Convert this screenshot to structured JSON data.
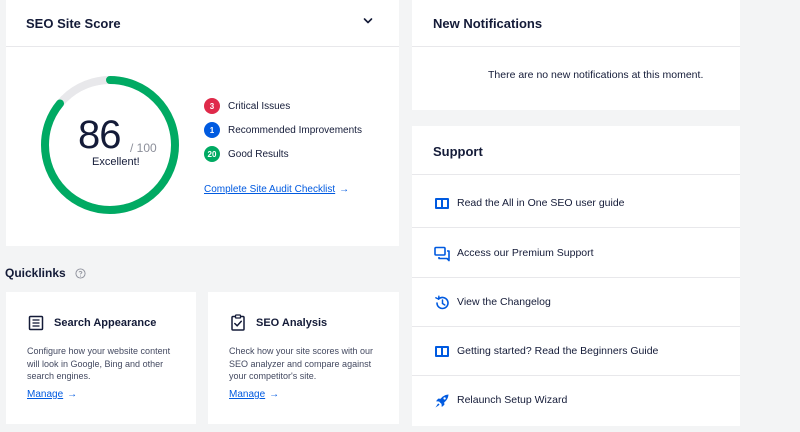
{
  "seo_score": {
    "title": "SEO Site Score",
    "score": "86",
    "total": "/ 100",
    "rating": "Excellent!",
    "score_value": 86,
    "score_max": 100,
    "ring_color": "#00aa63",
    "stats": [
      {
        "count": "3",
        "label": "Critical Issues",
        "color": "#df2a4a"
      },
      {
        "count": "1",
        "label": "Recommended Improvements",
        "color": "#005ae0"
      },
      {
        "count": "20",
        "label": "Good Results",
        "color": "#00aa63"
      }
    ],
    "audit_link": "Complete Site Audit Checklist",
    "audit_arrow": "→"
  },
  "notifications": {
    "title": "New Notifications",
    "empty_message": "There are no new notifications at this moment."
  },
  "support": {
    "title": "Support",
    "items": [
      {
        "label": "Read the All in One SEO user guide",
        "icon": "book-icon"
      },
      {
        "label": "Access our Premium Support",
        "icon": "chat-icon"
      },
      {
        "label": "View the Changelog",
        "icon": "history-icon"
      },
      {
        "label": "Getting started? Read the Beginners Guide",
        "icon": "book-icon"
      },
      {
        "label": "Relaunch Setup Wizard",
        "icon": "rocket-icon"
      }
    ]
  },
  "quicklinks": {
    "title": "Quicklinks",
    "help_icon": "question-icon",
    "items": [
      {
        "title": "Search Appearance",
        "description": "Configure how your website content will look in Google, Bing and other search engines.",
        "link": "Manage",
        "arrow": "→",
        "icon": "list-icon"
      },
      {
        "title": "SEO Analysis",
        "description": "Check how your site scores with our SEO analyzer and compare against your competitor's site.",
        "link": "Manage",
        "arrow": "→",
        "icon": "clipboard-check-icon"
      }
    ]
  },
  "colors": {
    "accent": "#005ae0",
    "text": "#141b38",
    "background": "#f3f4f5"
  }
}
